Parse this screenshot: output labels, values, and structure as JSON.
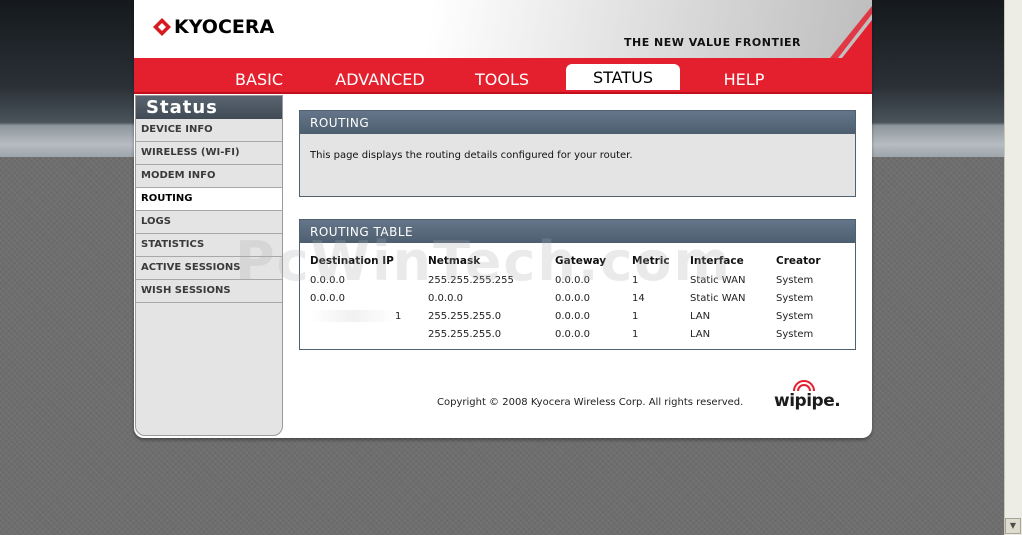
{
  "header": {
    "logo_text": "KYOCERA",
    "tagline": "THE NEW VALUE FRONTIER"
  },
  "nav": {
    "tabs": [
      "BASIC",
      "ADVANCED",
      "TOOLS",
      "STATUS",
      "HELP"
    ],
    "active": "STATUS"
  },
  "sidebar": {
    "title": "Status",
    "items": [
      "DEVICE INFO",
      "WIRELESS (WI-FI)",
      "MODEM INFO",
      "ROUTING",
      "LOGS",
      "STATISTICS",
      "ACTIVE SESSIONS",
      "WISH SESSIONS"
    ],
    "active": "ROUTING"
  },
  "routing": {
    "title": "ROUTING",
    "description": "This page displays the routing details configured for your router."
  },
  "routing_table": {
    "title": "ROUTING TABLE",
    "columns": [
      "Destination IP",
      "Netmask",
      "Gateway",
      "Metric",
      "Interface",
      "Creator"
    ],
    "rows": [
      [
        "0.0.0.0",
        "255.255.255.255",
        "0.0.0.0",
        "1",
        "Static WAN",
        "System"
      ],
      [
        "0.0.0.0",
        "0.0.0.0",
        "0.0.0.0",
        "14",
        "Static WAN",
        "System"
      ],
      [
        "1",
        "255.255.255.0",
        "0.0.0.0",
        "1",
        "LAN",
        "System"
      ],
      [
        "",
        "255.255.255.0",
        "0.0.0.0",
        "1",
        "LAN",
        "System"
      ]
    ]
  },
  "footer": {
    "copyright": "Copyright © 2008 Kyocera Wireless Corp. All rights reserved.",
    "brand": "wipipe."
  },
  "watermark": "PcWinTech.com",
  "colors": {
    "nav_red": "#e5202e",
    "section_header": "#4d5e70",
    "sidebar_bg": "#e4e4e4"
  }
}
